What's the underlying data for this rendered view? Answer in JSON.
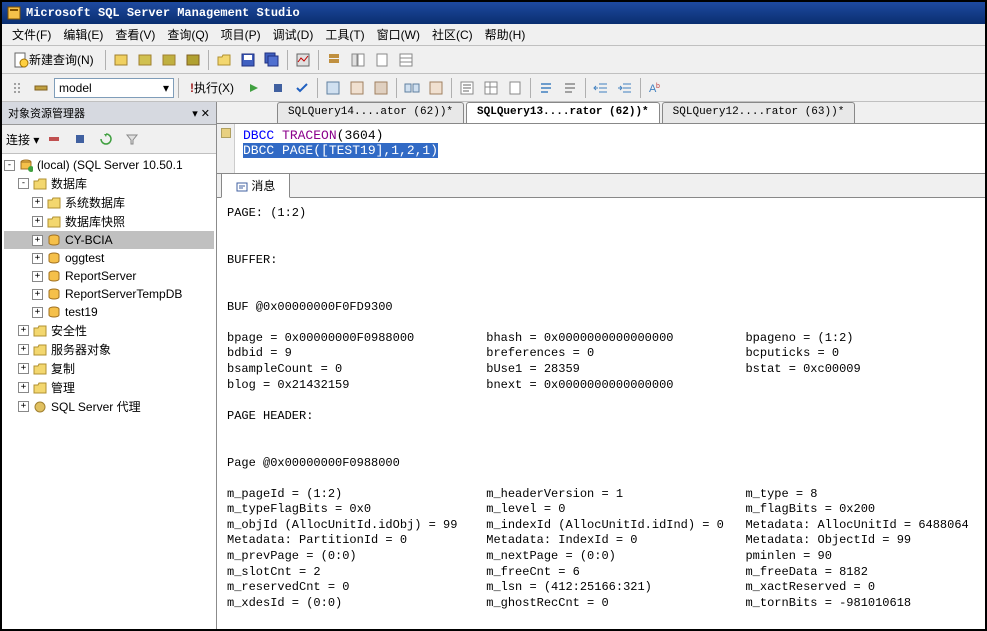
{
  "title": "Microsoft SQL Server Management Studio",
  "menu": {
    "file": "文件(F)",
    "edit": "编辑(E)",
    "view": "查看(V)",
    "query": "查询(Q)",
    "project": "项目(P)",
    "debug": "调试(D)",
    "tools": "工具(T)",
    "window": "窗口(W)",
    "community": "社区(C)",
    "help": "帮助(H)"
  },
  "toolbar": {
    "new_query": "新建查询(N)",
    "db_selected": "model",
    "execute": "执行(X)"
  },
  "sidebar": {
    "title": "对象资源管理器",
    "connect": "连接 ▾",
    "root": "(local) (SQL Server 10.50.1",
    "databases": "数据库",
    "sys_db": "系统数据库",
    "db_snapshots": "数据库快照",
    "db_items": [
      "CY-BCIA",
      "oggtest",
      "ReportServer",
      "ReportServerTempDB",
      "test19"
    ],
    "security": "安全性",
    "server_objects": "服务器对象",
    "replication": "复制",
    "management": "管理",
    "agent": "SQL Server 代理"
  },
  "tabs": [
    "SQLQuery14....ator (62))*",
    "SQLQuery13....rator (62))*",
    "SQLQuery12....rator (63))*"
  ],
  "code": {
    "line1_kw": "DBCC",
    "line1_func": "TRACEON",
    "line1_args": "(3604)",
    "line2_full": "DBCC PAGE([TEST19],1,2,1)"
  },
  "messages_tab": "消息",
  "messages": "PAGE: (1:2)\n\n\nBUFFER:\n\n\nBUF @0x00000000F0FD9300\n\nbpage = 0x00000000F0988000          bhash = 0x0000000000000000          bpageno = (1:2)\nbdbid = 9                           breferences = 0                     bcputicks = 0\nbsampleCount = 0                    bUse1 = 28359                       bstat = 0xc00009\nblog = 0x21432159                   bnext = 0x0000000000000000          \n\nPAGE HEADER:\n\n\nPage @0x00000000F0988000\n\nm_pageId = (1:2)                    m_headerVersion = 1                 m_type = 8\nm_typeFlagBits = 0x0                m_level = 0                         m_flagBits = 0x200\nm_objId (AllocUnitId.idObj) = 99    m_indexId (AllocUnitId.idInd) = 0   Metadata: AllocUnitId = 6488064\nMetadata: PartitionId = 0           Metadata: IndexId = 0               Metadata: ObjectId = 99\nm_prevPage = (0:0)                  m_nextPage = (0:0)                  pminlen = 90\nm_slotCnt = 2                       m_freeCnt = 6                       m_freeData = 8182\nm_reservedCnt = 0                   m_lsn = (412:25166:321)             m_xactReserved = 0\nm_xdesId = (0:0)                    m_ghostRecCnt = 0                   m_tornBits = -981010618"
}
